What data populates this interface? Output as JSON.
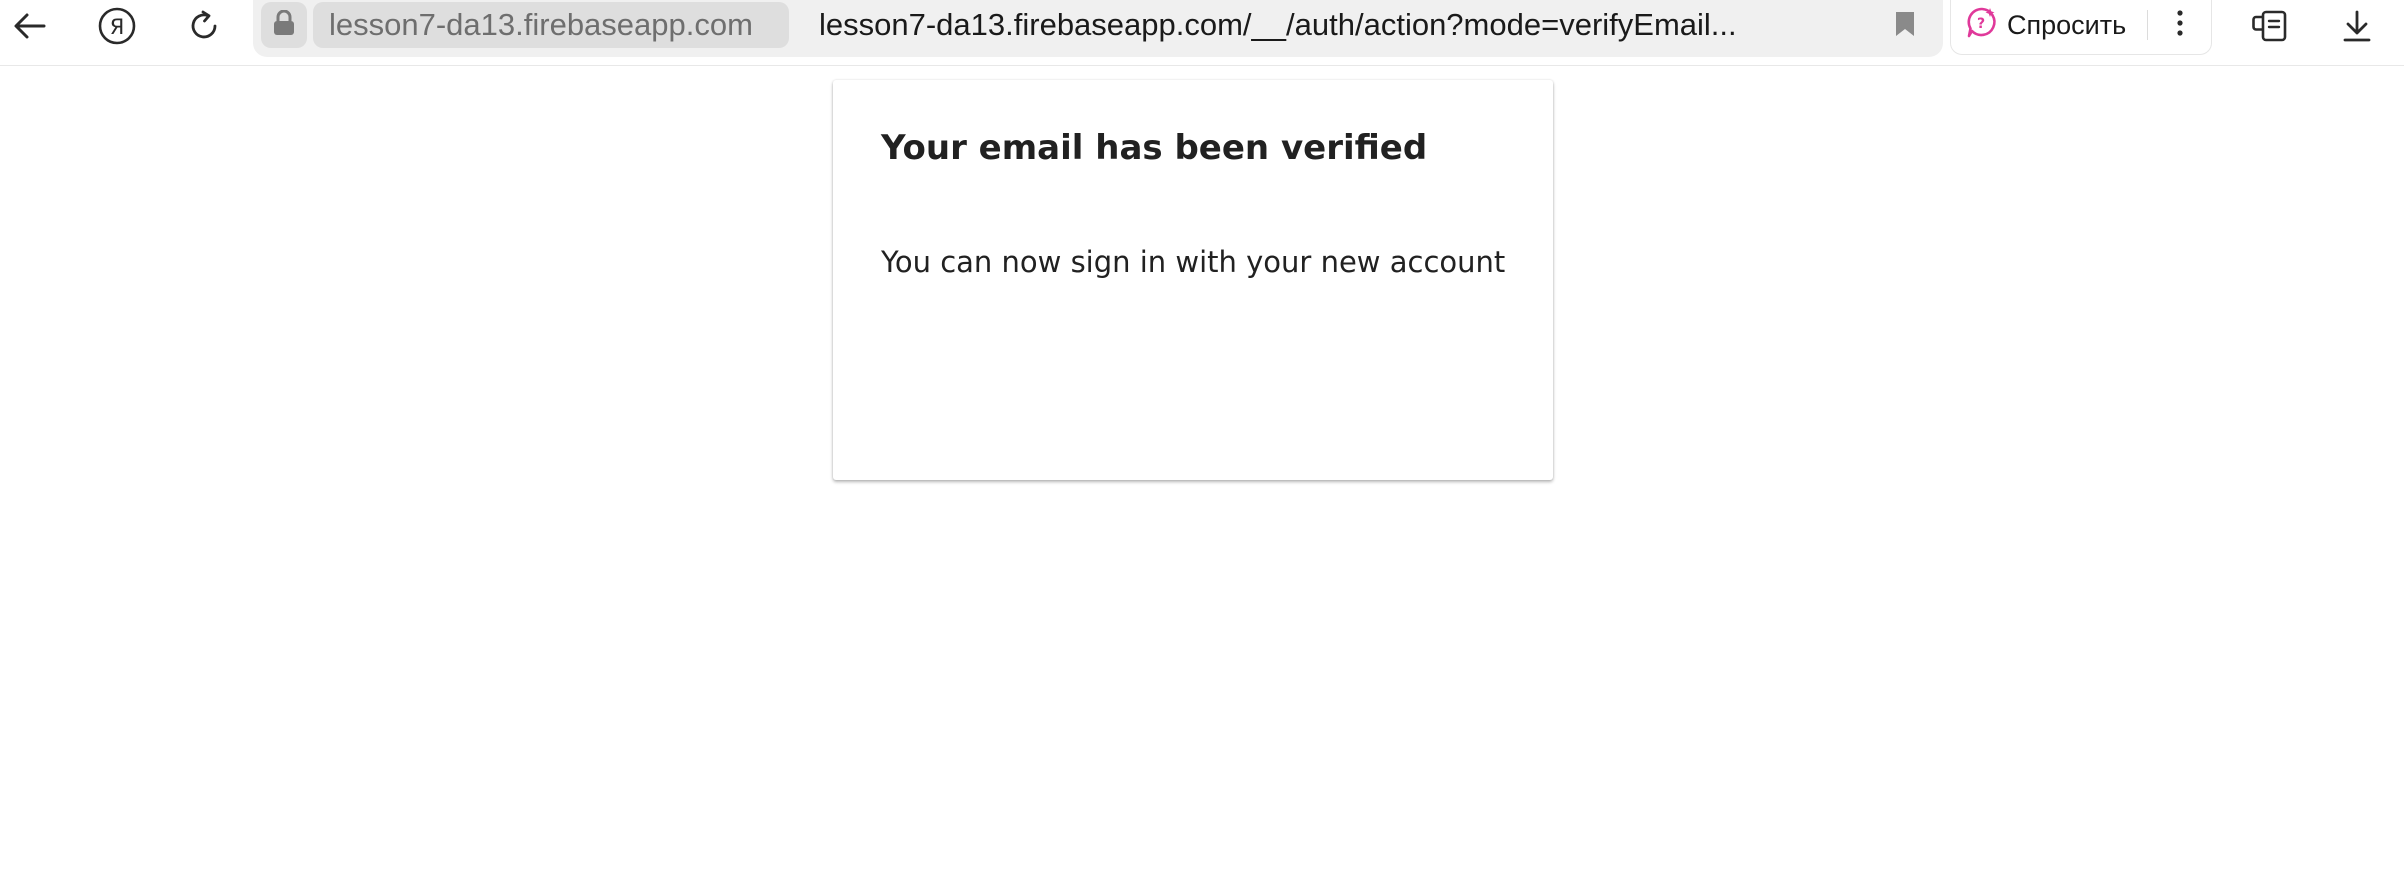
{
  "browser": {
    "domain": "lesson7-da13.firebaseapp.com",
    "url": "lesson7-da13.firebaseapp.com/__/auth/action?mode=verifyEmail...",
    "ask_label": "Спросить",
    "icons": {
      "back": "back-arrow-icon",
      "yandex": "yandex-logo-icon",
      "reload": "reload-icon",
      "lock": "lock-icon",
      "bookmark": "bookmark-icon",
      "ask": "ai-chat-icon",
      "more": "more-vertical-icon",
      "tabs": "tabs-collections-icon",
      "download": "download-icon"
    },
    "colors": {
      "omnibox": "#f0f0f0",
      "pill": "#dedede",
      "ask_icon": "#e0399a"
    }
  },
  "card": {
    "title": "Your email has been verified",
    "message": "You can now sign in with your new account"
  }
}
